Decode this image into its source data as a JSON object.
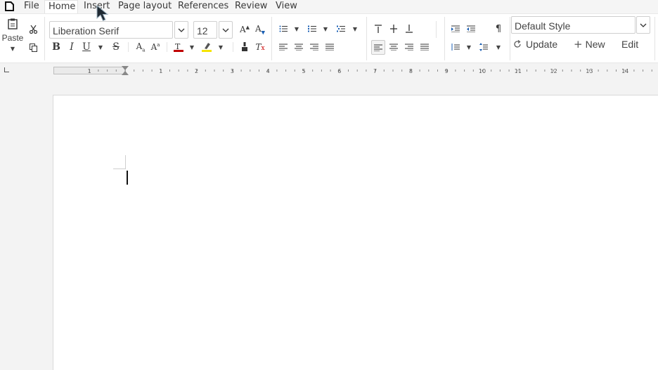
{
  "menubar": {
    "items": [
      {
        "label": "File"
      },
      {
        "label": "Home"
      },
      {
        "label": "Insert"
      },
      {
        "label": "Page layout"
      },
      {
        "label": "References"
      },
      {
        "label": "Review"
      },
      {
        "label": "View"
      }
    ],
    "active": "Home"
  },
  "toolbar": {
    "paste_label": "Paste",
    "font_name": "Liberation Serif",
    "font_size": "12",
    "paragraph_style": "Default Style",
    "update_label": "Update",
    "new_label": "New",
    "edit_label": "Edit",
    "bold_glyph": "B",
    "italic_glyph": "I",
    "underline_glyph": "U",
    "strike_glyph": "S",
    "pilcrow_glyph": "¶",
    "font_color": "#c00000",
    "highlight_color": "#f5e400"
  },
  "ruler": {
    "numbers": [
      "1",
      "1",
      "2",
      "3",
      "4",
      "5",
      "6",
      "7",
      "8",
      "9",
      "10",
      "11",
      "12",
      "13",
      "14"
    ]
  }
}
